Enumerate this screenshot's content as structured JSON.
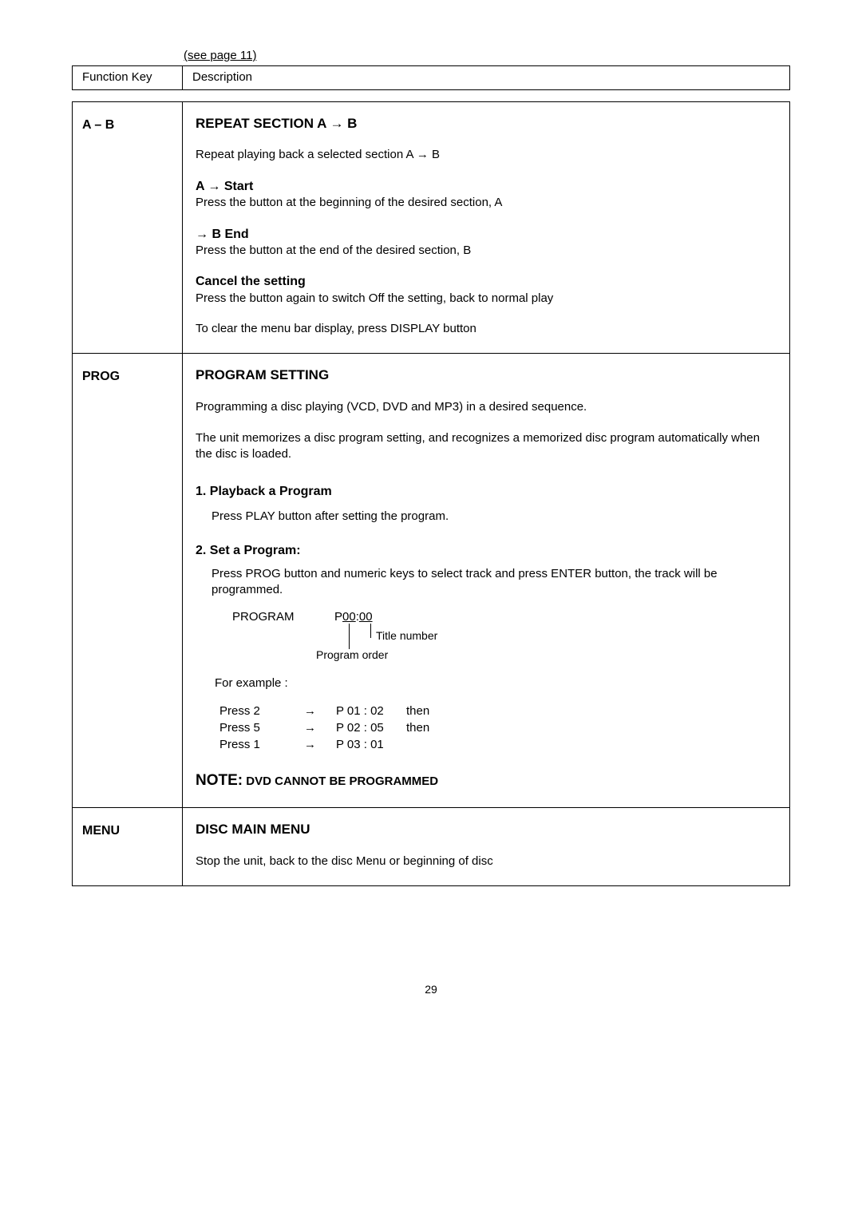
{
  "see_page": "(see page 11)",
  "header": {
    "function_key": "Function Key",
    "description": "Description"
  },
  "rows": {
    "ab": {
      "key": "A – B",
      "title": "REPEAT SECTION A → B",
      "repeat_text": "Repeat playing back a selected section A → B",
      "a_start": "A →  Start",
      "a_start_desc": "Press the button at the beginning of the desired section, A",
      "b_end": "→ B  End",
      "b_end_desc": "Press the button at the end of the desired section, B",
      "cancel_title": "Cancel the setting",
      "cancel_desc": "Press the button again to switch Off the setting, back to normal play",
      "clear_text": "To clear the menu bar display, press DISPLAY button"
    },
    "prog": {
      "key": "PROG",
      "title": "PROGRAM SETTING",
      "intro": "Programming a disc playing (VCD, DVD and MP3) in a desired sequence.",
      "memorize": "The unit memorizes a disc program setting, and recognizes a memorized disc program automatically when the disc is loaded.",
      "playback_heading": "1. Playback a Program",
      "playback_desc": "Press PLAY button after setting the program.",
      "set_heading": "2. Set a Program:",
      "set_desc": "Press PROG button and numeric keys to select track and press ENTER button, the track will be programmed.",
      "diagram": {
        "program_label": "PROGRAM",
        "p_label_prefix": "P ",
        "p_val1": "00",
        "p_sep": " : ",
        "p_val2": "00",
        "title_number": "Title number",
        "program_order": "Program order"
      },
      "example_label": "For example :",
      "presses": [
        {
          "btn": "Press 2",
          "arrow": "→",
          "code": "P 01 : 02",
          "then": "then"
        },
        {
          "btn": "Press 5",
          "arrow": "→",
          "code": "P 02 : 05",
          "then": "then"
        },
        {
          "btn": "Press 1",
          "arrow": "→",
          "code": "P 03 : 01",
          "then": ""
        }
      ],
      "note_big": "NOTE:",
      "note_small": " DVD CANNOT BE PROGRAMMED"
    },
    "menu": {
      "key": "MENU",
      "title": "DISC MAIN MENU",
      "desc": "Stop the unit, back to the disc Menu or beginning of disc"
    }
  },
  "page_number": "29"
}
